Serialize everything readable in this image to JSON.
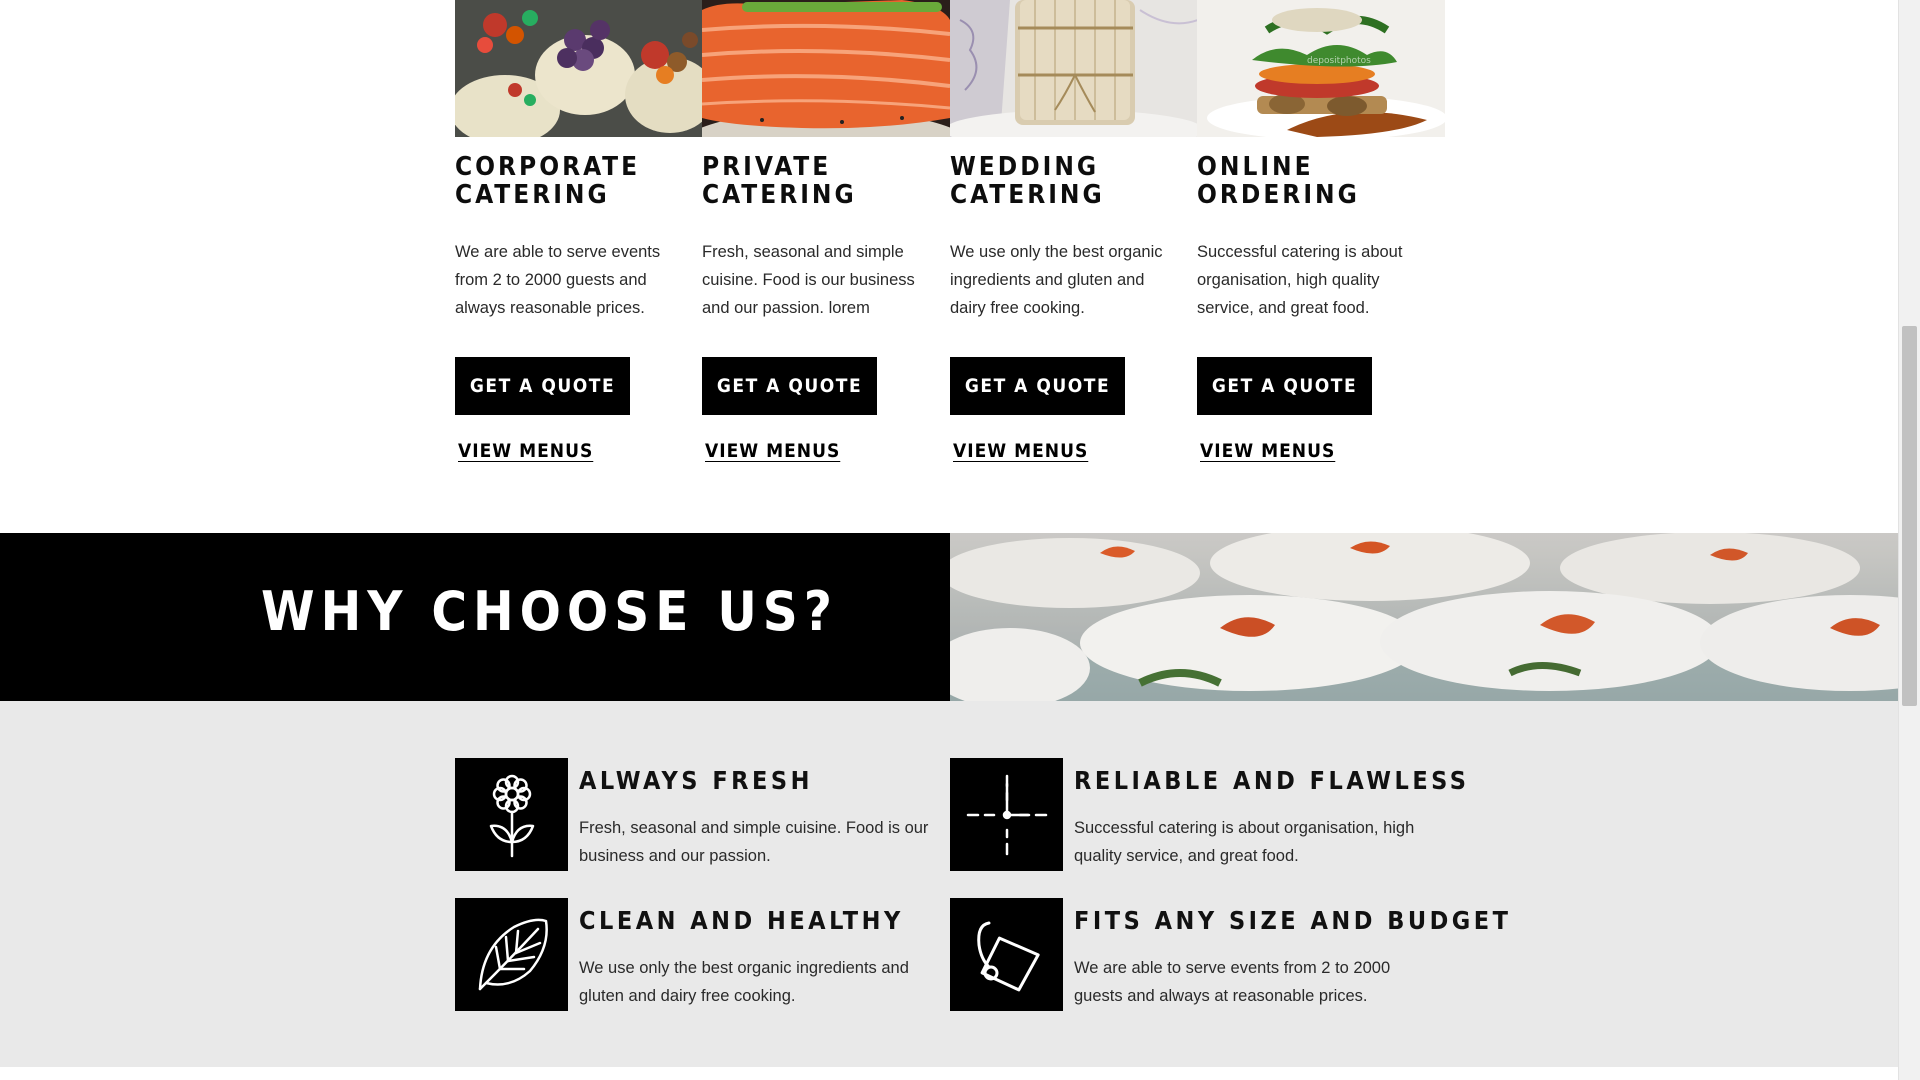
{
  "services": [
    {
      "title": "CORPORATE\nCATERING",
      "description": "We are able to serve events from 2 to 2000 guests and always reasonable prices.",
      "button_label": "GET A QUOTE",
      "link_label": "VIEW MENUS",
      "image": "appetizer-platter"
    },
    {
      "title": "PRIVATE\nCATERING",
      "description": "Fresh, seasonal and simple cuisine. Food is our business and our passion. lorem",
      "button_label": "GET A QUOTE",
      "link_label": "VIEW MENUS",
      "image": "salmon-fillet"
    },
    {
      "title": "WEDDING\nCATERING",
      "description": "We use only the best organic ingredients and gluten and dairy free cooking.",
      "button_label": "GET A QUOTE",
      "link_label": "VIEW MENUS",
      "image": "tied-sandwiches"
    },
    {
      "title": "ONLINE\nORDERING",
      "description": "Successful catering is about organisation, high quality service, and great food.",
      "button_label": "GET A QUOTE",
      "link_label": "VIEW MENUS",
      "image": "stacked-burger"
    }
  ],
  "why": {
    "title": "WHY CHOOSE US?",
    "image": "plated-appetizers"
  },
  "features": [
    {
      "title": "ALWAYS FRESH",
      "description": "Fresh, seasonal and simple cuisine. Food is our business and our passion.",
      "icon": "flower-icon"
    },
    {
      "title": "RELIABLE AND FLAWLESS",
      "description": "Successful catering is about organisation, high quality service, and great food.",
      "icon": "clock-icon"
    },
    {
      "title": "CLEAN AND HEALTHY",
      "description": "We use only the best organic ingredients and gluten and dairy free cooking.",
      "icon": "leaf-icon"
    },
    {
      "title": "FITS ANY SIZE AND BUDGET",
      "description": "We are able to serve events from 2 to 2000 guests and always at reasonable prices.",
      "icon": "price-tag-icon"
    }
  ],
  "colors": {
    "primary": "#000000",
    "features_background": "#e9e9e9",
    "text": "#2a2a2a"
  }
}
